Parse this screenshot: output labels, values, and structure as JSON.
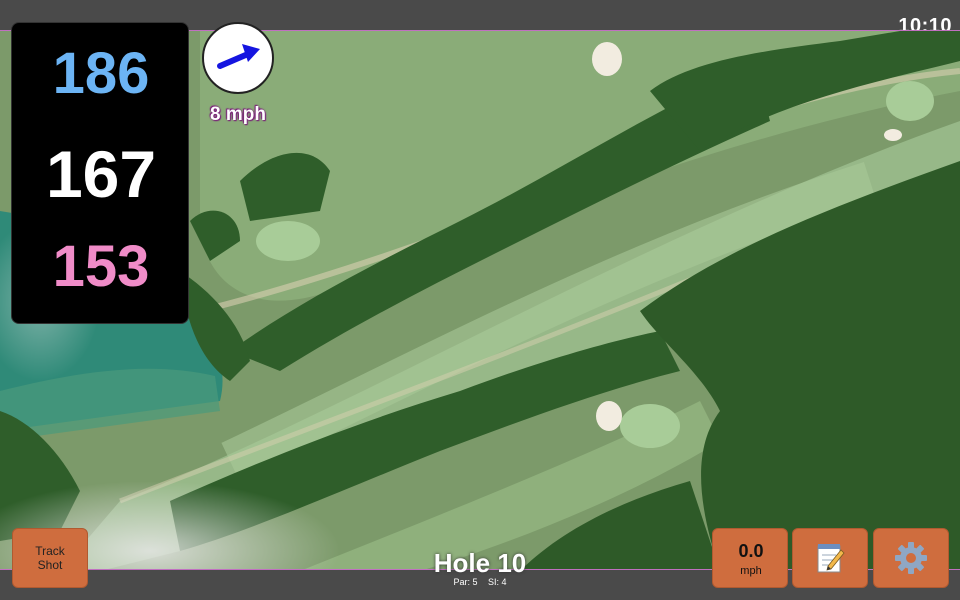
{
  "status": {
    "time": "10:10"
  },
  "distances": {
    "back": "186",
    "middle": "167",
    "front": "153"
  },
  "colors": {
    "back": "#6cb4f4",
    "middle": "#ffffff",
    "front": "#f08cc8",
    "button": "#cf6d3e"
  },
  "wind": {
    "speed_label": "8 mph",
    "icon": "arrow-icon"
  },
  "buttons": {
    "track_shot_line1": "Track",
    "track_shot_line2": "Shot",
    "speed_value": "0.0",
    "speed_unit": "mph",
    "notes_icon": "notepad-icon",
    "settings_icon": "gear-icon"
  },
  "hole": {
    "title": "Hole 10",
    "par": "Par: 5",
    "si": "SI: 4"
  }
}
